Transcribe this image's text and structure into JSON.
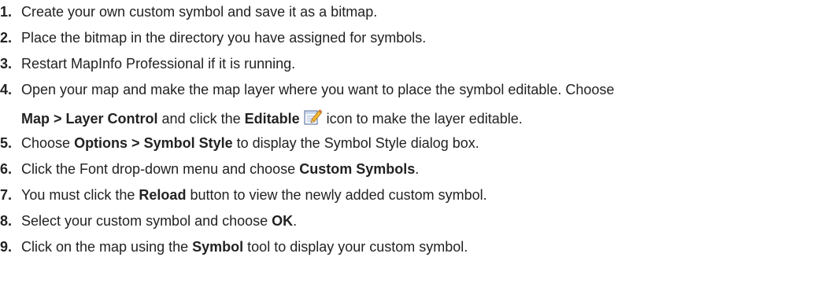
{
  "steps": [
    {
      "num": "1",
      "text": "Create your own custom symbol and save it as a bitmap."
    },
    {
      "num": "2",
      "text": "Place the bitmap in the directory you have assigned for symbols."
    },
    {
      "num": "3",
      "text": "Restart MapInfo Professional if it is running."
    },
    {
      "num": "4",
      "line1": "Open your map and make the map layer where you want to place the symbol editable. Choose",
      "menu_path": "Map > Layer Control",
      "and_click": "and click the",
      "editable": "Editable",
      "icon": "edit-pencil-icon",
      "end": "icon to make the layer editable."
    },
    {
      "num": "5",
      "pre": "Choose",
      "bold": "Options > Symbol Style",
      "post": "to display the Symbol Style dialog box."
    },
    {
      "num": "6",
      "pre": "Click the Font drop-down menu and choose",
      "bold": "Custom Symbols",
      "post": "."
    },
    {
      "num": "7",
      "pre": "You must click the",
      "bold": "Reload",
      "post": "button to view the newly added custom symbol."
    },
    {
      "num": "8",
      "pre": "Select your custom symbol and choose",
      "bold": "OK",
      "post": "."
    },
    {
      "num": "9",
      "pre": "Click on the map using the",
      "bold": "Symbol",
      "post": "tool to display your custom symbol."
    }
  ],
  "colors": {
    "text": "#222222",
    "background": "#ffffff"
  }
}
